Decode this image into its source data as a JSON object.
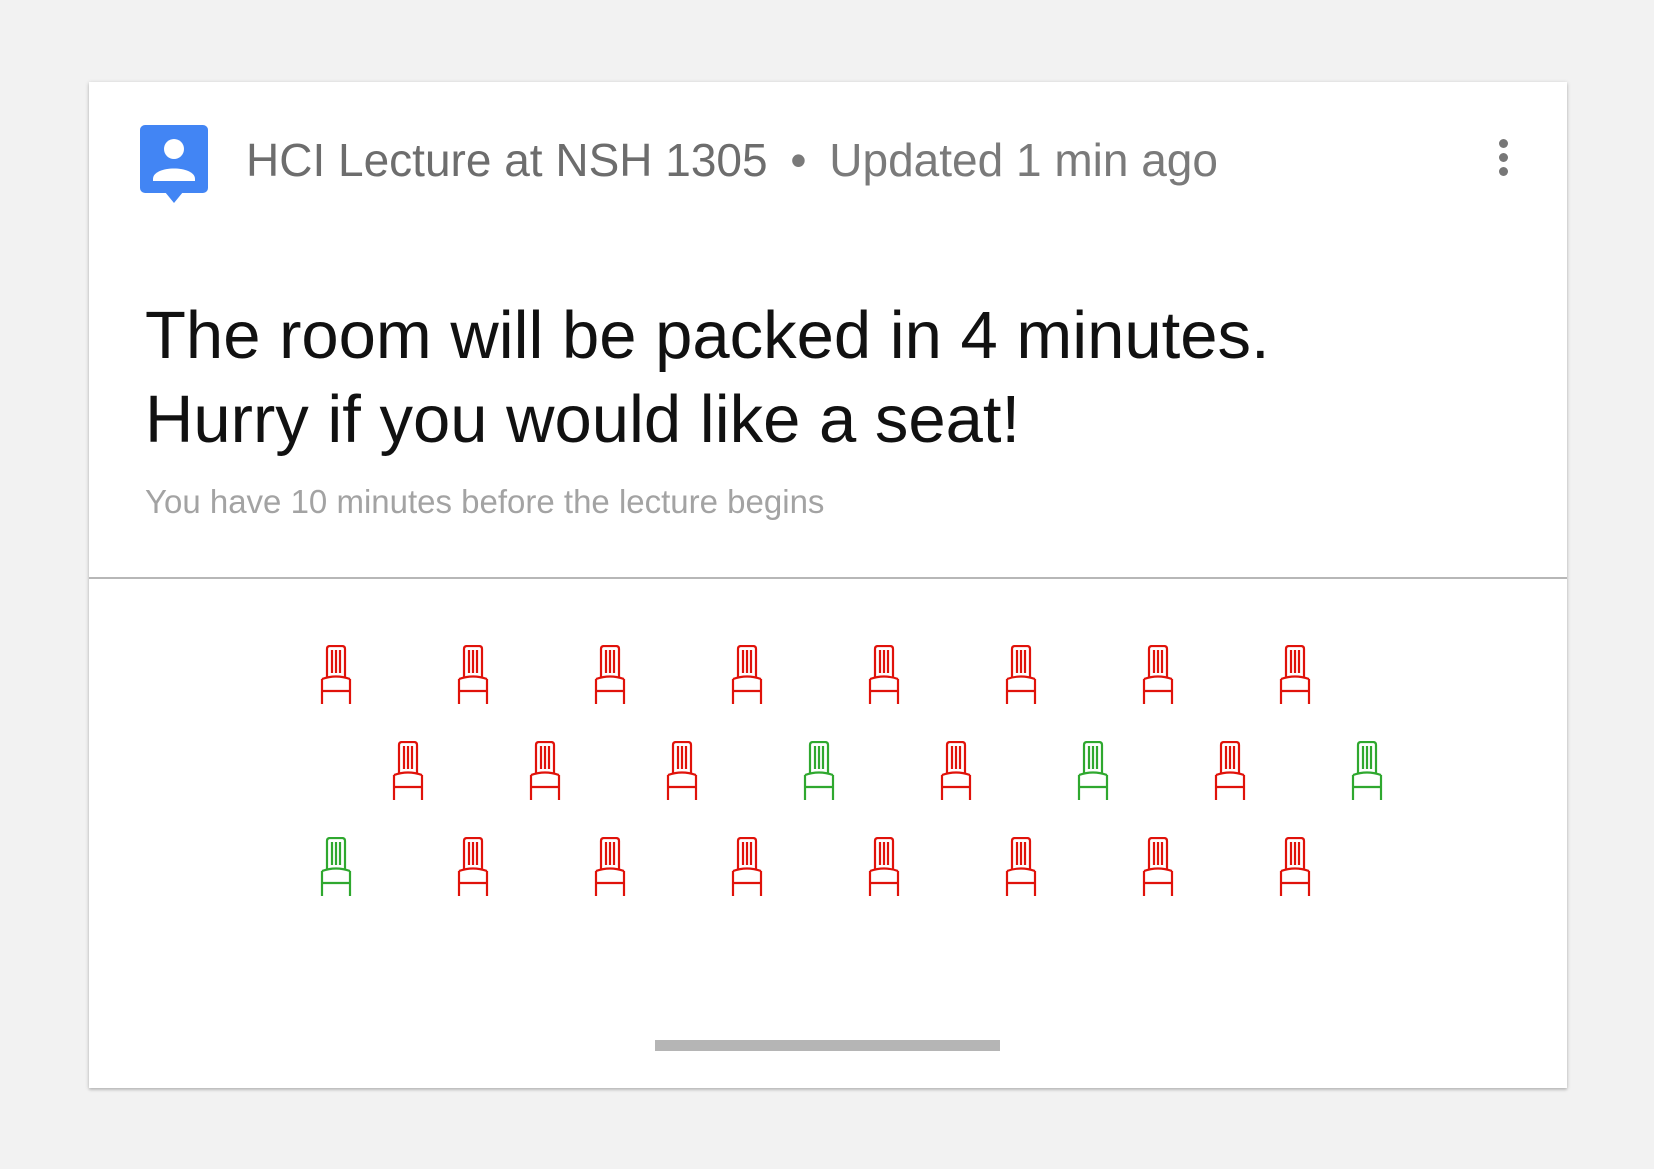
{
  "header": {
    "title": "HCI Lecture at NSH 1305",
    "separator": "•",
    "updated": "Updated 1 min ago",
    "app_icon": "person-pin-icon",
    "menu_icon": "more-vert-icon"
  },
  "message": {
    "line1": "The room will be packed in 4 minutes.",
    "line2": "Hurry if you would like a seat!",
    "subtext": "You have 10 minutes before the lecture begins"
  },
  "seat_map": {
    "icon": "chair-icon",
    "colors": {
      "occupied": "#e0120a",
      "available": "#2fa82f",
      "accent": "#4285f4"
    },
    "rows": [
      [
        "occupied",
        "occupied",
        "occupied",
        "occupied",
        "occupied",
        "occupied",
        "occupied",
        "occupied"
      ],
      [
        "occupied",
        "occupied",
        "occupied",
        "available",
        "occupied",
        "available",
        "occupied",
        "available"
      ],
      [
        "available",
        "occupied",
        "occupied",
        "occupied",
        "occupied",
        "occupied",
        "occupied",
        "occupied"
      ]
    ]
  }
}
